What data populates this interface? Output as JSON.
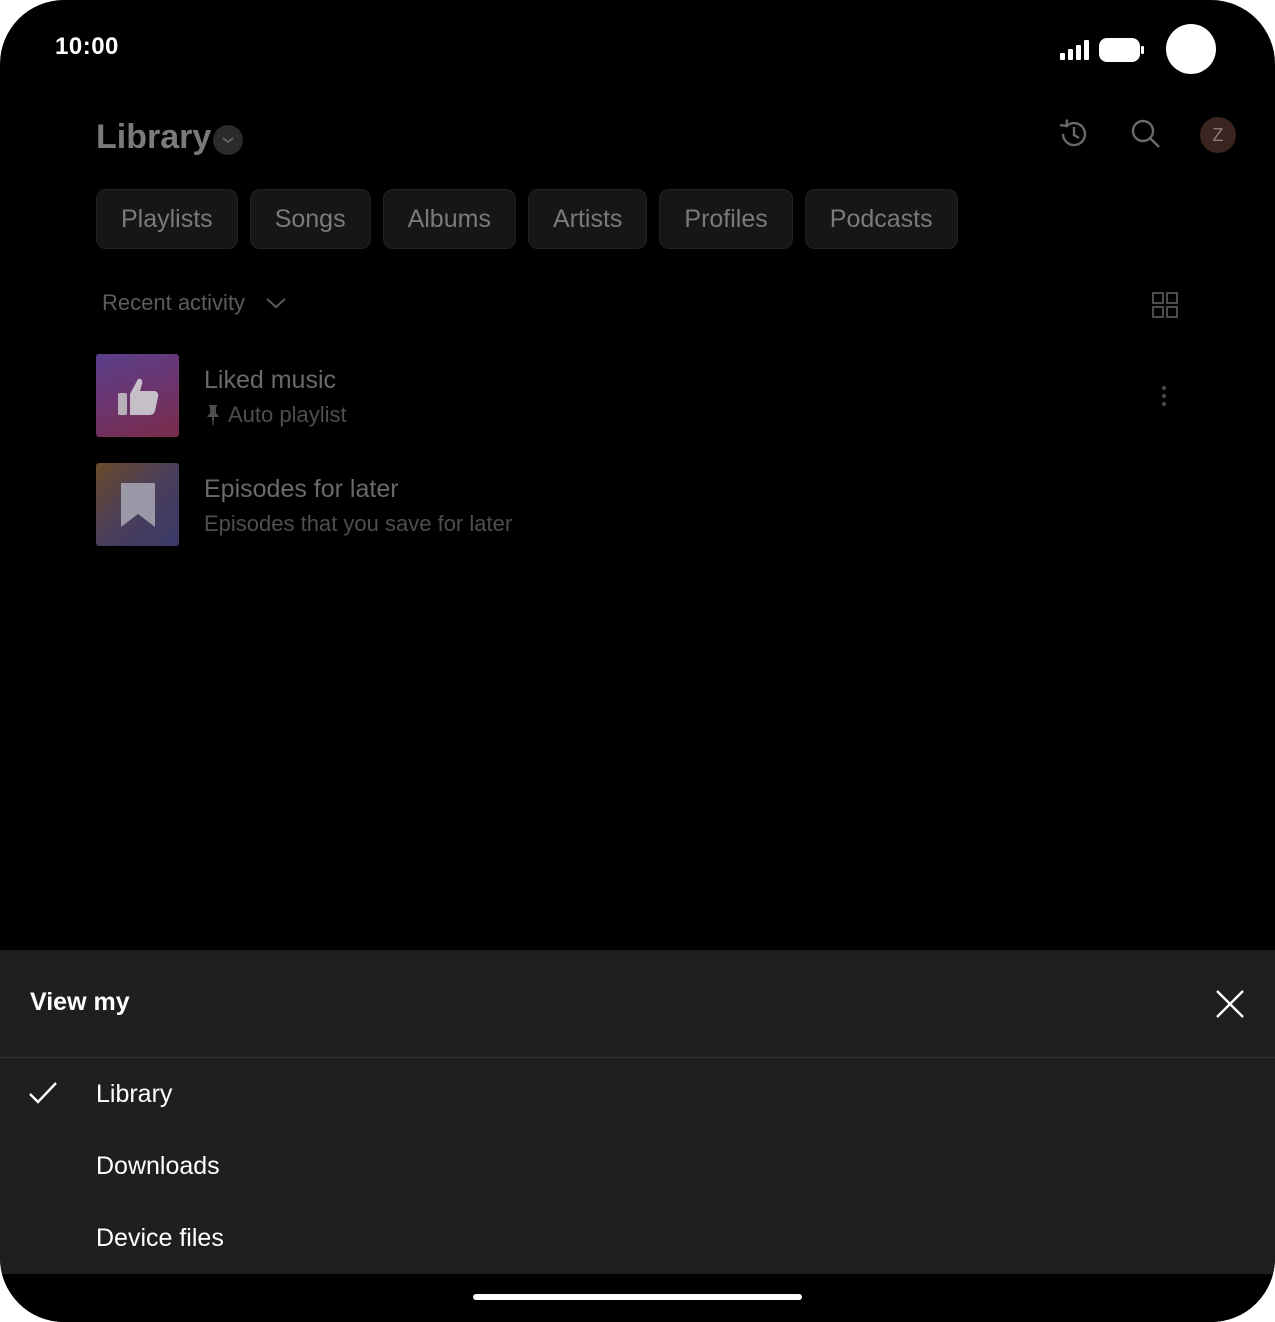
{
  "status_bar": {
    "time": "10:00"
  },
  "header": {
    "title": "Library",
    "avatar_initial": "Z",
    "icons": [
      "history-icon",
      "search-icon"
    ]
  },
  "chips": [
    "Playlists",
    "Songs",
    "Albums",
    "Artists",
    "Profiles",
    "Podcasts"
  ],
  "sort": {
    "label": "Recent activity"
  },
  "items": [
    {
      "title": "Liked music",
      "subtitle": "Auto playlist",
      "icon": "thumbs-up-icon",
      "pinned": true
    },
    {
      "title": "Episodes for later",
      "subtitle": "Episodes that you save for later",
      "icon": "bookmark-icon",
      "pinned": false
    }
  ],
  "sheet": {
    "title": "View my",
    "options": [
      {
        "label": "Library",
        "selected": true
      },
      {
        "label": "Downloads",
        "selected": false
      },
      {
        "label": "Device files",
        "selected": false
      }
    ]
  },
  "colors": {
    "background": "#000000",
    "sheet_background": "#1f1f1f",
    "text_primary": "#ffffff"
  }
}
